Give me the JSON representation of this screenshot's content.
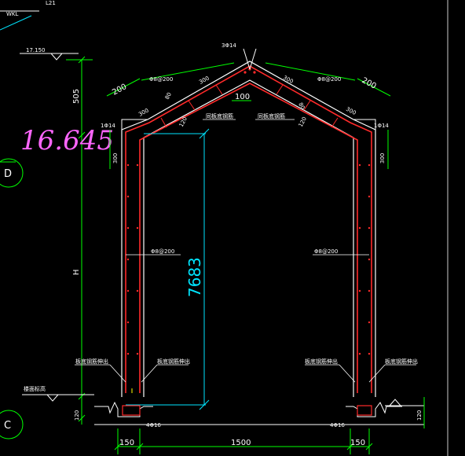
{
  "drawing": {
    "top_tag": "WKL",
    "top_tag2": "L21",
    "elevation": "17.150",
    "dim_vertical_505": "505",
    "dim_vertical_H": "H",
    "dim_vertical_120_left": "120",
    "dim_vertical_120_right": "120",
    "bottom_dim_150_left": "150",
    "bottom_dim_1500": "1500",
    "bottom_dim_150_right": "150",
    "ridge_bar": "3Φ14",
    "eave_bar_left": "1Φ14",
    "eave_bar_right": "1Φ14",
    "stirrup_top_left": "Φ8@200",
    "stirrup_top_right": "Φ8@200",
    "stirrup_wall_left": "Φ8@200",
    "stirrup_wall_right": "Φ8@200",
    "dim_200_left": "200",
    "dim_200_right": "200",
    "dim_300_a": "300",
    "dim_300_b": "300",
    "dim_300_c": "300",
    "dim_300_d": "300",
    "dim_300_side_left": "300",
    "dim_300_side_right": "300",
    "dim_100": "100",
    "dim_80_left": "80",
    "dim_80_right": "80",
    "dim_120_left": "120",
    "dim_120_right": "120",
    "note_left_inner": "同板底钢筋",
    "note_right_inner": "同板底钢筋",
    "note_bottom_1": "板底钢筋伸出",
    "note_bottom_2": "板底钢筋伸出",
    "note_bottom_3": "板底钢筋伸出",
    "note_bottom_4": "板底钢筋伸出",
    "note_slab_top": "楼面标高",
    "bottom_bars_left": "4Φ16",
    "bottom_bars_right": "4Φ16",
    "axis_d": "D",
    "axis_c": "C",
    "handwritten_value": "16.645",
    "cyan_dim": "7683",
    "colors": {
      "background": "#000000",
      "outline": "#ffffff",
      "rebar": "#ff2a2a",
      "dimension": "#00ff00",
      "handwriting": "#ff66ff",
      "cyan": "#00e5ff",
      "axis": "#00ff00",
      "yellow": "#ffff00"
    }
  }
}
